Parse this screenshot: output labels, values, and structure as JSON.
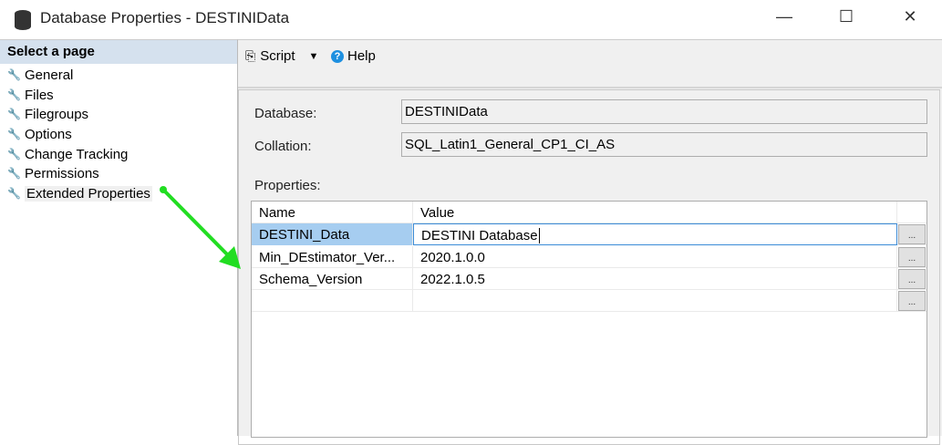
{
  "window": {
    "title": "Database Properties - DESTINIData",
    "minimize": "—",
    "maximize": "☐",
    "close": "✕"
  },
  "sidebar": {
    "header": "Select a page",
    "items": [
      {
        "label": "General"
      },
      {
        "label": "Files"
      },
      {
        "label": "Filegroups"
      },
      {
        "label": "Options"
      },
      {
        "label": "Change Tracking"
      },
      {
        "label": "Permissions"
      },
      {
        "label": "Extended Properties"
      }
    ]
  },
  "toolbar": {
    "script_label": "Script",
    "help_label": "Help"
  },
  "form": {
    "database_label": "Database:",
    "database_value": "DESTINIData",
    "collation_label": "Collation:",
    "collation_value": "SQL_Latin1_General_CP1_CI_AS",
    "properties_label": "Properties:"
  },
  "grid": {
    "headers": [
      "Name",
      "Value"
    ],
    "rows": [
      {
        "name": "DESTINI_Data",
        "value": "DESTINI Database"
      },
      {
        "name": "Min_DEstimator_Ver...",
        "value": "2020.1.0.0"
      },
      {
        "name": "Schema_Version",
        "value": "2022.1.0.5"
      },
      {
        "name": "",
        "value": ""
      }
    ],
    "ellipsis": "..."
  },
  "colors": {
    "selected_row": "#a6cdf0",
    "arrow": "#22dd22"
  }
}
